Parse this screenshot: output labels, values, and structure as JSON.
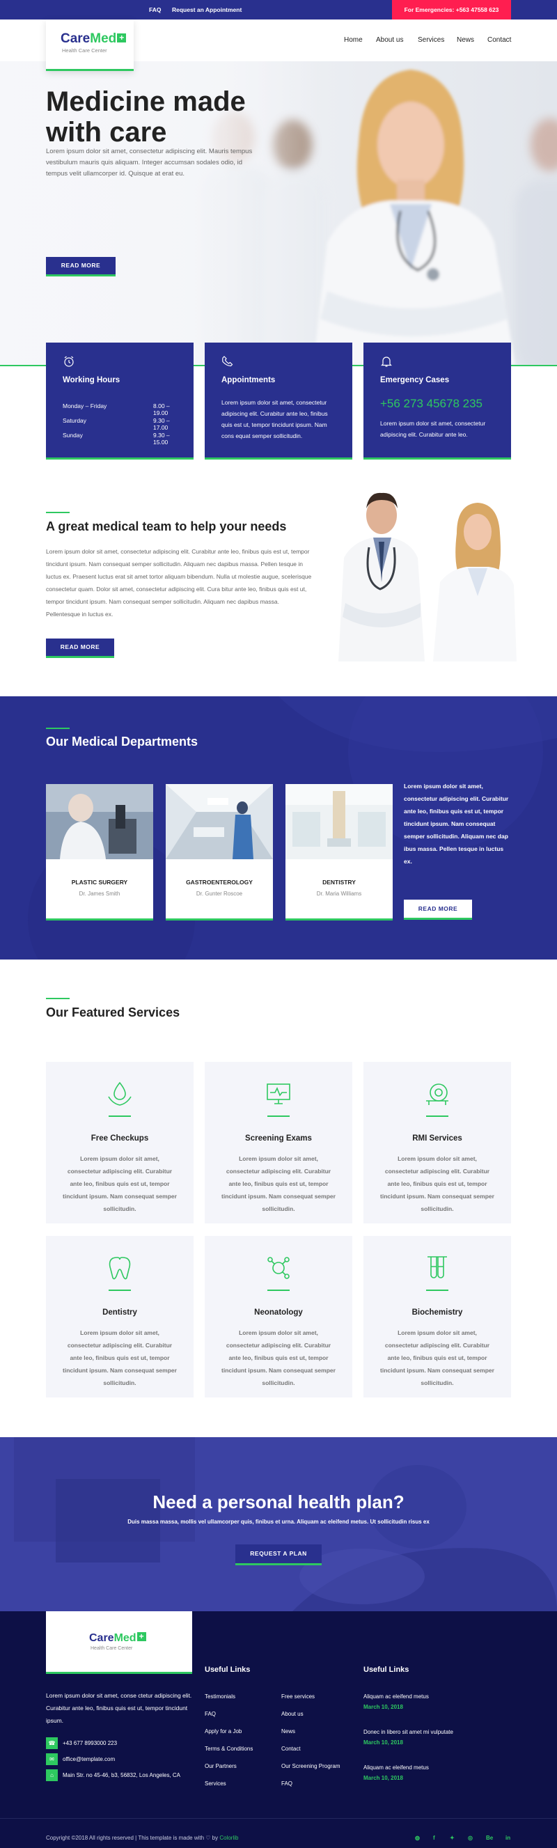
{
  "topbar": {
    "faq": "FAQ",
    "appointment": "Request an Appointment",
    "emergency": "For Emergencies: +563 47558 623"
  },
  "brand": {
    "name_a": "Care",
    "name_b": "Med",
    "plus": "+",
    "tagline": "Health Care Center"
  },
  "nav": [
    "Home",
    "About us",
    "Services",
    "News",
    "Contact"
  ],
  "hero": {
    "title_line1": "Medicine made",
    "title_line2": "with care",
    "text": "Lorem ipsum dolor sit amet, consectetur adipiscing elit. Mauris tempus vestibulum mauris quis aliquam. Integer accumsan sodales odio, id tempus velit ullamcorper id. Quisque at erat eu.",
    "button": "READ MORE"
  },
  "info": {
    "hours": {
      "title": "Working Hours",
      "rows": [
        {
          "day": "Monday – Friday",
          "time": "8.00 – 19.00"
        },
        {
          "day": "Saturday",
          "time": "9.30 – 17.00"
        },
        {
          "day": "Sunday",
          "time": "9.30 – 15.00"
        }
      ]
    },
    "appointments": {
      "title": "Appointments",
      "text": "Lorem ipsum dolor sit amet, consectetur adipiscing elit. Curabitur ante leo, finibus quis est ut, tempor tincidunt ipsum. Nam cons equat semper sollicitudin."
    },
    "emergency": {
      "title": "Emergency Cases",
      "phone": "+56 273 45678 235",
      "text": "Lorem ipsum dolor sit amet, consectetur adipiscing elit. Curabitur ante leo."
    }
  },
  "team": {
    "title": "A great medical team to help your needs",
    "text": "Lorem ipsum dolor sit amet, consectetur adipiscing elit. Curabitur ante leo, finibus quis est ut, tempor tincidunt ipsum. Nam consequat semper sollicitudin. Aliquam nec dapibus massa. Pellen tesque in luctus ex. Praesent luctus erat sit amet tortor aliquam bibendum. Nulla ut molestie augue, scelerisque consectetur quam. Dolor sit amet, consectetur adipiscing elit. Cura bitur ante leo, finibus quis est ut, tempor tincidunt ipsum. Nam consequat semper sollicitudin. Aliquam nec dapibus massa. Pellentesque in luctus ex.",
    "button": "READ MORE"
  },
  "departments": {
    "title": "Our Medical Departments",
    "cards": [
      {
        "name": "PLASTIC SURGERY",
        "doctor": "Dr. James Smith"
      },
      {
        "name": "GASTROENTEROLOGY",
        "doctor": "Dr. Gunter Roscoe"
      },
      {
        "name": "DENTISTRY",
        "doctor": "Dr. Maria Williams"
      }
    ],
    "text": "Lorem ipsum dolor sit amet, consectetur adipiscing elit. Curabitur ante leo, finibus quis est ut, tempor tincidunt ipsum. Nam consequat semper sollicitudin. Aliquam nec dap ibus massa. Pellen tesque in luctus ex.",
    "button": "READ MORE"
  },
  "services": {
    "title": "Our Featured Services",
    "items": [
      {
        "name": "Free Checkups",
        "icon": "hand-drop-icon",
        "text": "Lorem ipsum dolor sit amet, consectetur adipiscing elit. Curabitur ante leo, finibus quis est ut, tempor tincidunt ipsum. Nam consequat semper sollicitudin."
      },
      {
        "name": "Screening Exams",
        "icon": "monitor-pulse-icon",
        "text": "Lorem ipsum dolor sit amet, consectetur adipiscing elit. Curabitur ante leo, finibus quis est ut, tempor tincidunt ipsum. Nam consequat semper sollicitudin."
      },
      {
        "name": "RMI Services",
        "icon": "scanner-icon",
        "text": "Lorem ipsum dolor sit amet, consectetur adipiscing elit. Curabitur ante leo, finibus quis est ut, tempor tincidunt ipsum. Nam consequat semper sollicitudin."
      },
      {
        "name": "Dentistry",
        "icon": "tooth-icon",
        "text": "Lorem ipsum dolor sit amet, consectetur adipiscing elit. Curabitur ante leo, finibus quis est ut, tempor tincidunt ipsum. Nam consequat semper sollicitudin."
      },
      {
        "name": "Neonatology",
        "icon": "molecule-icon",
        "text": "Lorem ipsum dolor sit amet, consectetur adipiscing elit. Curabitur ante leo, finibus quis est ut, tempor tincidunt ipsum. Nam consequat semper sollicitudin."
      },
      {
        "name": "Biochemistry",
        "icon": "test-tubes-icon",
        "text": "Lorem ipsum dolor sit amet, consectetur adipiscing elit. Curabitur ante leo, finibus quis est ut, tempor tincidunt ipsum. Nam consequat semper sollicitudin."
      }
    ]
  },
  "plan": {
    "title": "Need a personal health plan?",
    "text": "Duis massa massa, mollis vel ullamcorper quis, finibus et urna. Aliquam ac eleifend metus. Ut sollicitudin risus ex",
    "button": "REQUEST A PLAN"
  },
  "footer": {
    "about": "Lorem ipsum dolor sit amet, conse ctetur adipiscing elit. Curabitur ante leo, finibus quis est ut, tempor tincidunt ipsum.",
    "phone": "+43 677 8993000 223",
    "email": "office@template.com",
    "address": "Main Str. no 45-46, b3, 56832, Los Angeles, CA",
    "links_title": "Useful Links",
    "links_col1": [
      "Testimonials",
      "FAQ",
      "Apply for a Job",
      "Terms & Conditions",
      "Our Partners",
      "Services"
    ],
    "links_col2": [
      "Free services",
      "About us",
      "News",
      "Contact",
      "Our Screening Program",
      "FAQ"
    ],
    "news_title": "Useful Links",
    "news": [
      {
        "title": "Aliquam ac eleifend metus",
        "date": "March 10, 2018"
      },
      {
        "title": "Donec in libero sit amet mi vulputate",
        "date": "March 10, 2018"
      },
      {
        "title": "Aliquam ac eleifend metus",
        "date": "March 10, 2018"
      }
    ],
    "copyright": "Copyright ©2018 All rights reserved | This template is made with ♡ by",
    "credit": "Colorlib",
    "social": [
      "◍",
      "f",
      "✦",
      "◎",
      "Be",
      "in"
    ]
  },
  "colors": {
    "primary": "#29308e",
    "accent": "#2ec860",
    "emergency": "#ff1e50",
    "footer": "#0d1046"
  }
}
